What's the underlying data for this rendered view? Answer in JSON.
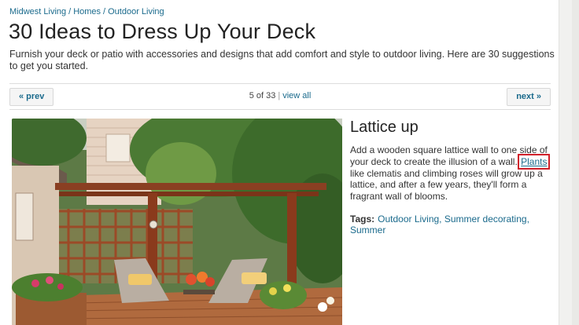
{
  "breadcrumb": {
    "items": [
      "Midwest Living",
      "Homes",
      "Outdoor Living"
    ],
    "separator": "/"
  },
  "page": {
    "title": "30 Ideas to Dress Up Your Deck",
    "description": "Furnish your deck or patio with accessories and designs that add comfort and style to outdoor living. Here are 30 suggestions to get you started."
  },
  "pager": {
    "prev_label": "« prev",
    "next_label": "next »",
    "position": "5 of 33",
    "separator": "|",
    "view_all_label": "view all"
  },
  "slide": {
    "title": "Lattice up",
    "text_before": "Add a wooden square lattice wall to one side of your deck to create the illusion of a wall. ",
    "link_text": "Plants",
    "text_after": " like clematis and climbing roses will grow up a lattice, and after a few years, they'll form a fragrant wall of blooms.",
    "tags_label": "Tags:",
    "tags": [
      "Outdoor Living",
      "Summer decorating",
      "Summer"
    ]
  },
  "colors": {
    "link": "#1a6a8c",
    "highlight_box": "#d0202a"
  },
  "icons": {
    "photo": "deck-lattice-photo"
  }
}
